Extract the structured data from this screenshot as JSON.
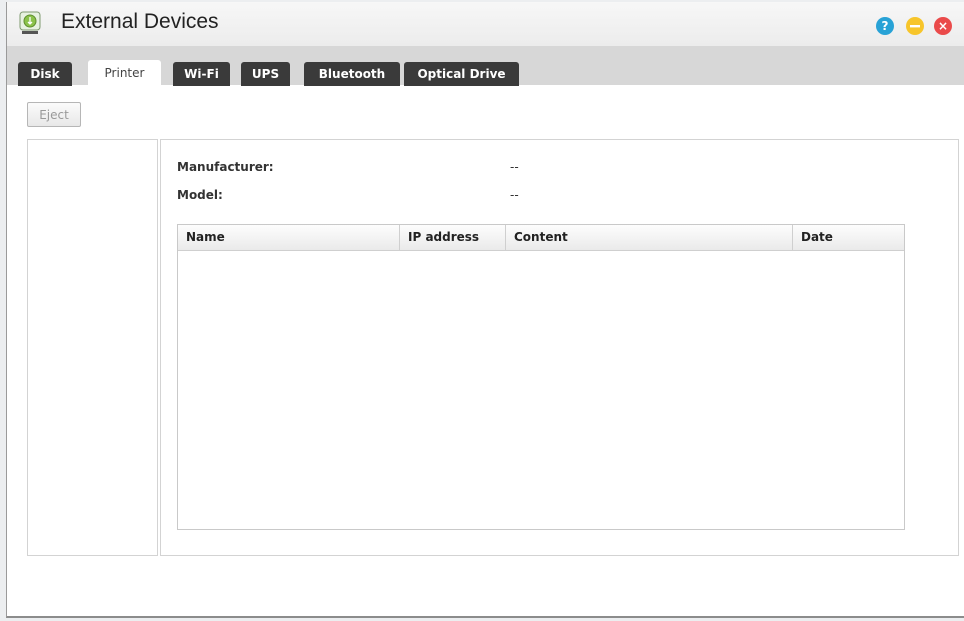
{
  "window": {
    "title": "External Devices"
  },
  "titlebar_buttons": {
    "help_icon": "?",
    "close_icon": "×"
  },
  "tabs": [
    {
      "label": "Disk",
      "active": false
    },
    {
      "label": "Printer",
      "active": true
    },
    {
      "label": "Wi-Fi",
      "active": false
    },
    {
      "label": "UPS",
      "active": false
    },
    {
      "label": "Bluetooth",
      "active": false
    },
    {
      "label": "Optical Drive",
      "active": false
    }
  ],
  "toolbar": {
    "eject_label": "Eject"
  },
  "details": {
    "manufacturer_label": "Manufacturer:",
    "manufacturer_value": "--",
    "model_label": "Model:",
    "model_value": "--"
  },
  "table": {
    "columns": [
      "Name",
      "IP address",
      "Content",
      "Date"
    ],
    "rows": []
  },
  "colors": {
    "tab_inactive": "#3a3a3a",
    "help": "#28a2d6",
    "minimize": "#f7c52a",
    "close": "#ea4a4a"
  }
}
